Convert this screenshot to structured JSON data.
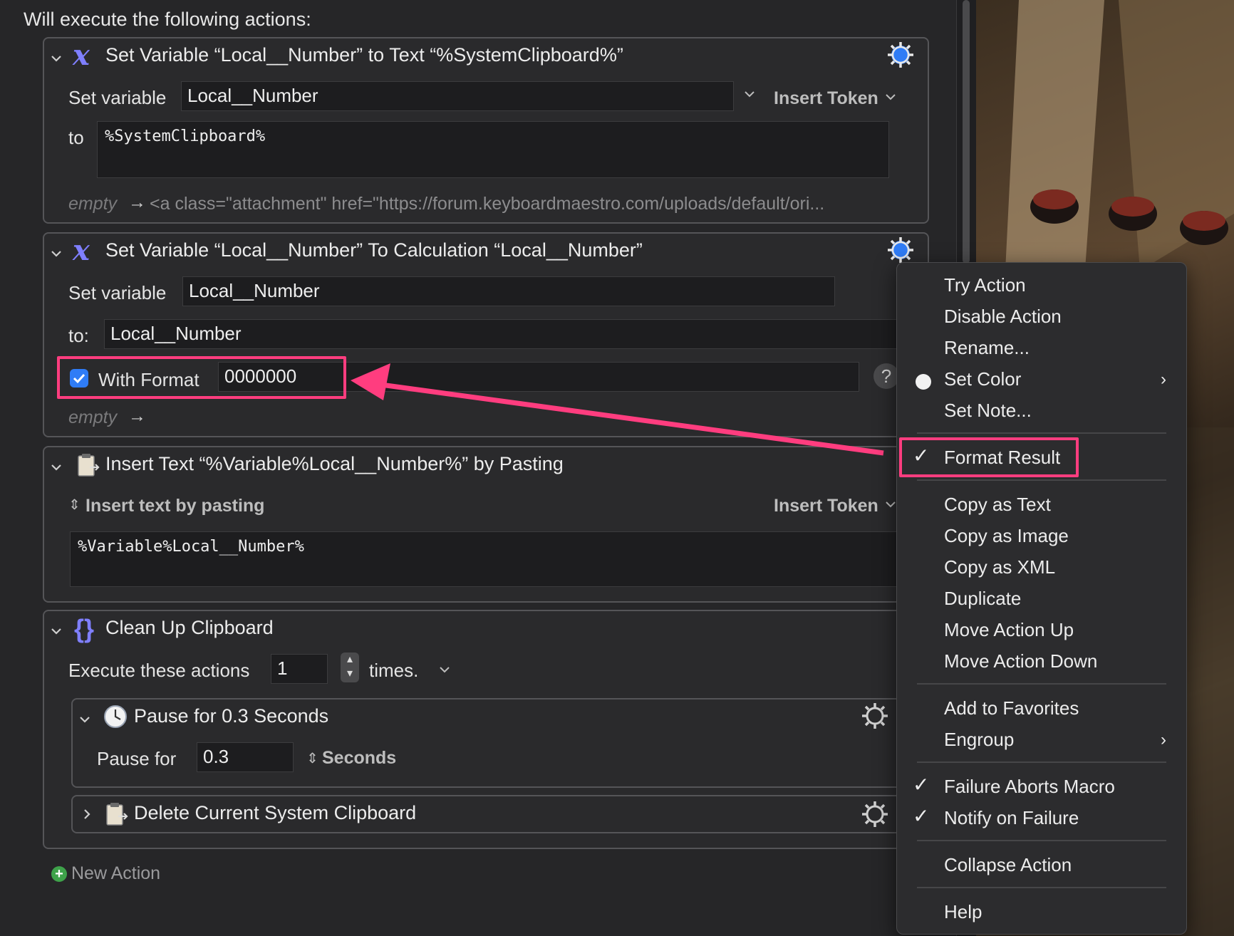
{
  "header": {
    "title": "Will execute the following actions:"
  },
  "action1": {
    "title": "Set Variable “Local__Number” to Text “%SystemClipboard%”",
    "set_variable_label": "Set variable",
    "variable_value": "Local__Number",
    "insert_token_label": "Insert Token",
    "to_label": "to",
    "text_value": "%SystemClipboard%",
    "result_empty": "empty",
    "result_text": "<a class=\"attachment\" href=\"https://forum.keyboardmaestro.com/uploads/default/ori..."
  },
  "action2": {
    "title": "Set Variable “Local__Number” To Calculation “Local__Number”",
    "set_variable_label": "Set variable",
    "variable_value": "Local__Number",
    "to_label": "to:",
    "calc_value": "Local__Number",
    "with_format_label": "With Format",
    "with_format_checked": true,
    "format_value": "0000000",
    "help_label": "?",
    "result_empty": "empty"
  },
  "action3": {
    "title": "Insert Text “%Variable%Local__Number%” by Pasting",
    "mode_label": "Insert text by pasting",
    "insert_token_label": "Insert Token",
    "text_value": "%Variable%Local__Number%"
  },
  "action4": {
    "title": "Clean Up Clipboard",
    "execute_label": "Execute these actions",
    "times_value": "1",
    "times_label": "times.",
    "pause": {
      "title": "Pause for 0.3 Seconds",
      "pause_label": "Pause for",
      "value": "0.3",
      "unit": "Seconds"
    },
    "delete": {
      "title": "Delete Current System Clipboard"
    }
  },
  "new_action_label": "New Action",
  "menu": {
    "items": [
      "Try Action",
      "Disable Action",
      "Rename...",
      "Set Color",
      "Set Note...",
      "Format Result",
      "Copy as Text",
      "Copy as Image",
      "Copy as XML",
      "Duplicate",
      "Move Action Up",
      "Move Action Down",
      "Add to Favorites",
      "Engroup",
      "Failure Aborts Macro",
      "Notify on Failure",
      "Collapse Action",
      "Help"
    ],
    "checked": [
      "Format Result",
      "Failure Aborts Macro",
      "Notify on Failure"
    ]
  },
  "colors": {
    "accent_highlight": "#ff3d7f",
    "checkbox_blue": "#2f7cf6",
    "gear_blue": "#2f7cf6",
    "variable_icon": "#7f7fff"
  }
}
